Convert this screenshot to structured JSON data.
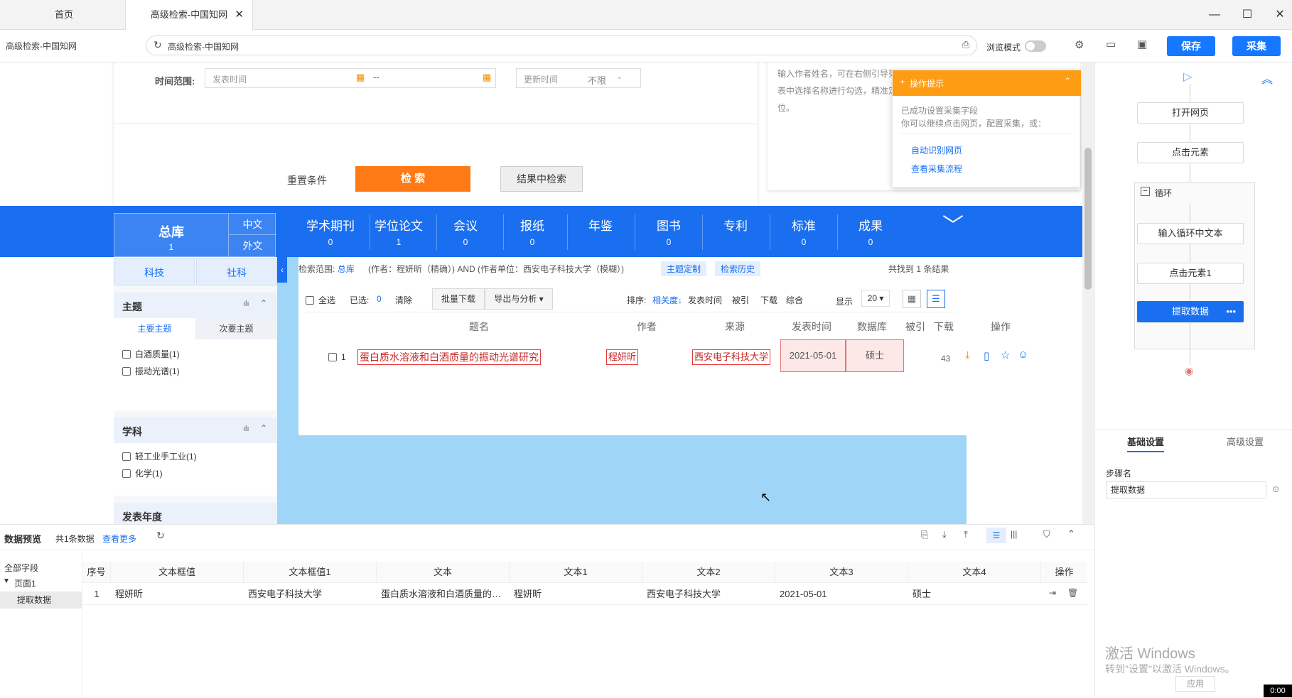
{
  "tabs": [
    {
      "label": "首页"
    },
    {
      "label": "高级检索-中国知网"
    }
  ],
  "addr": {
    "page_title": "高级检索-中国知网",
    "url": "高级检索-中国知网",
    "browse_mode": "浏览模式",
    "save": "保存",
    "collect": "采集"
  },
  "search_form": {
    "time_label": "时间范围:",
    "publish_placeholder": "发表时间",
    "dash": "--",
    "update_label": "更新时间",
    "update_value": "不限",
    "reset": "重置条件",
    "search": "检 索",
    "search_in_results": "结果中检索"
  },
  "side_hint": {
    "text": "输入作者姓名，可在右侧引导列表中选择名称进行勾选，精准定位。"
  },
  "tip_popup": {
    "title": "操作提示",
    "line1": "已成功设置采集字段",
    "line2": "你可以继续点击网页，配置采集，或：",
    "link1": "自动识别网页",
    "link2": "查看采集流程"
  },
  "nav": {
    "main": {
      "label": "总库",
      "count": "1",
      "lang_zh": "中文",
      "lang_en": "外文"
    },
    "items": [
      {
        "label": "学术期刊",
        "count": "0"
      },
      {
        "label": "学位论文",
        "count": "1"
      },
      {
        "label": "会议",
        "count": "0"
      },
      {
        "label": "报纸",
        "count": "0"
      },
      {
        "label": "年鉴",
        "count": ""
      },
      {
        "label": "图书",
        "count": "0"
      },
      {
        "label": "专利",
        "count": ""
      },
      {
        "label": "标准",
        "count": "0"
      },
      {
        "label": "成果",
        "count": "0"
      }
    ]
  },
  "left_filter": {
    "tab1": "科技",
    "tab2": "社科",
    "topic": {
      "title": "主题",
      "sub1": "主要主题",
      "sub2": "次要主题",
      "items": [
        "白酒质量(1)",
        "振动光谱(1)"
      ]
    },
    "subject": {
      "title": "学科",
      "items": [
        "轻工业手工业(1)",
        "化学(1)"
      ]
    },
    "year": {
      "title": "发表年度"
    }
  },
  "results": {
    "scope_label": "检索范围:",
    "scope_value": "总库",
    "scope_query": "(作者：程妍昕（精确）) AND (作者单位：西安电子科技大学（模糊）)",
    "topic_btn": "主题定制",
    "history_btn": "检索历史",
    "found": "共找到 1 条结果",
    "select_all": "全选",
    "selected_label": "已选:",
    "selected_count": "0",
    "clear": "清除",
    "batch_download": "批量下载",
    "export": "导出与分析",
    "sort_label": "排序:",
    "sort_relevance": "相关度",
    "sort_date": "发表时间",
    "sort_cited": "被引",
    "sort_download": "下载",
    "sort_overall": "综合",
    "show_label": "显示",
    "show_value": "20",
    "headers": {
      "title": "题名",
      "author": "作者",
      "source": "来源",
      "date": "发表时间",
      "db": "数据库",
      "cited": "被引",
      "download": "下载",
      "ops": "操作"
    },
    "rows": [
      {
        "idx": "1",
        "title": "蛋白质水溶液和白酒质量的振动光谱研究",
        "author": "程妍昕",
        "source": "西安电子科技大学",
        "date": "2021-05-01",
        "db": "硕士",
        "cited": "",
        "download": "43"
      }
    ]
  },
  "flow": {
    "steps": [
      "打开网页",
      "点击元素",
      "循环",
      "输入循环中文本",
      "点击元素1",
      "提取数据"
    ]
  },
  "settings": {
    "tab_basic": "基础设置",
    "tab_advanced": "高级设置",
    "step_name_label": "步骤名",
    "step_name_value": "提取数据"
  },
  "watermark": {
    "line1": "激活 Windows",
    "line2": "转到\"设置\"以激活 Windows。",
    "apply": "应用"
  },
  "clock": "0:00",
  "preview": {
    "title": "数据预览",
    "count": "共1条数据",
    "more": "查看更多",
    "tree_all": "全部字段",
    "tree_page": "页面1",
    "tree_extract": "提取数据",
    "columns": [
      "序号",
      "文本框值",
      "文本框值1",
      "文本",
      "文本1",
      "文本2",
      "文本3",
      "文本4",
      "操作"
    ],
    "rows": [
      [
        "1",
        "程妍昕",
        "西安电子科技大学",
        "蛋白质水溶液和白酒质量的振动光谱研究",
        "程妍昕",
        "西安电子科技大学",
        "2021-05-01",
        "硕士"
      ]
    ]
  }
}
